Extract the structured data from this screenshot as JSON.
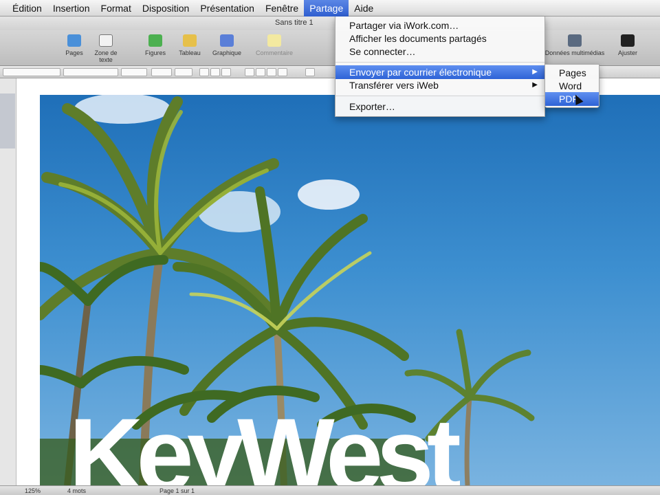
{
  "menubar": {
    "items": [
      "Édition",
      "Insertion",
      "Format",
      "Disposition",
      "Présentation",
      "Fenêtre",
      "Partage",
      "Aide"
    ],
    "active": "Partage"
  },
  "window": {
    "title": "Sans titre 1"
  },
  "toolbar": {
    "items": [
      {
        "label": "Pages",
        "icon": "pages-icon",
        "color": "#4a90d9"
      },
      {
        "label": "Zone de texte",
        "icon": "textbox-icon",
        "color": "#f2f2f2"
      },
      {
        "label": "Figures",
        "icon": "shapes-icon",
        "color": "#4cb050"
      },
      {
        "label": "Tableau",
        "icon": "table-icon",
        "color": "#e6c04a"
      },
      {
        "label": "Graphique",
        "icon": "chart-icon",
        "color": "#5a7fd8"
      },
      {
        "label": "Commentaire",
        "icon": "comment-icon",
        "color": "#f3e9a0"
      }
    ],
    "right_items": [
      {
        "label": "Données multimédias",
        "icon": "media-icon"
      },
      {
        "label": "Ajuster",
        "icon": "adjust-icon"
      }
    ]
  },
  "share_menu": {
    "items": [
      {
        "label": "Partager via iWork.com…",
        "submenu": false
      },
      {
        "label": "Afficher les documents partagés",
        "submenu": false
      },
      {
        "label": "Se connecter…",
        "submenu": false
      },
      {
        "label": "Envoyer par courrier électronique",
        "submenu": true,
        "highlighted": true
      },
      {
        "label": "Transférer vers iWeb",
        "submenu": true
      },
      {
        "label": "Exporter…",
        "submenu": false
      }
    ]
  },
  "email_submenu": {
    "items": [
      {
        "label": "Pages"
      },
      {
        "label": "Word"
      },
      {
        "label": "PDF",
        "highlighted": true
      }
    ]
  },
  "document": {
    "headline": "KeyWest"
  },
  "statusbar": {
    "zoom": "125%",
    "word_count": "4 mots",
    "page_info": "Page 1 sur 1"
  },
  "colors": {
    "menu_highlight": "#2e63d6",
    "sky": "#2a7cc4"
  }
}
